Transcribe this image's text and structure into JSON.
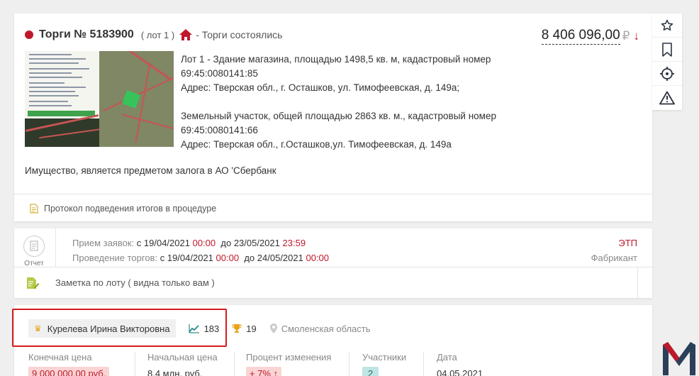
{
  "lot": {
    "title": "Торги № 5183900",
    "lot_number": "( лот 1 )",
    "status": "- Торги состоялись",
    "price": "8 406 096,00",
    "currency": "₽",
    "description_lines": [
      "Лот 1 - Здание магазина, площадью 1498,5 кв. м, кадастровый номер",
      "69:45:0080141:85",
      "Адрес: Тверская обл., г. Осташков, ул. Тимофеевская, д. 149а;",
      "",
      "Земельный участок, общей площадью 2863 кв. м., кадастровый номер",
      "69:45:0080141:66",
      "Адрес: Тверская обл., г.Осташков,ул. Тимофеевская, д. 149а"
    ],
    "note": "Имущество, является предметом залога в АО 'Сбербанк",
    "protocol_link": "Протокол подведения итогов в процедуре"
  },
  "schedule": {
    "report_label": "Отчет",
    "applications_label": "Прием заявок:",
    "applications_from_prefix": "с",
    "applications_from_date": "19/04/2021",
    "applications_from_time": "00:00",
    "applications_to_prefix": "до",
    "applications_to_date": "23/05/2021",
    "applications_to_time": "23:59",
    "auction_label": "Проведение торгов:",
    "auction_from_prefix": "с",
    "auction_from_date": "19/04/2021",
    "auction_from_time": "00:00",
    "auction_to_prefix": "до",
    "auction_to_date": "24/05/2021",
    "auction_to_time": "00:00",
    "etp_label": "ЭТП",
    "etp_name": "Фабрикант",
    "lot_note": "Заметка по лоту ( видна только вам )"
  },
  "winner": {
    "name": "Курелева Ирина Викторовна",
    "trend_count": "183",
    "trophy_count": "19",
    "region": "Смоленская область",
    "metrics": [
      {
        "label": "Конечная цена",
        "value": "9 000 000,00 руб."
      },
      {
        "label": "Начальная цена",
        "value": "8,4 млн. руб."
      },
      {
        "label": "Процент изменения",
        "value": "+ 7% ↑"
      },
      {
        "label": "Участники",
        "value": "2"
      },
      {
        "label": "Дата",
        "value": "04.05.2021"
      }
    ]
  },
  "side_toolbar": [
    "star-icon",
    "bookmark-icon",
    "target-icon",
    "warning-icon"
  ],
  "colors": {
    "accent_red": "#c0182b",
    "highlight_box": "#d21b1b",
    "teal_badge": "#bfe4e4",
    "crown": "#e8a31b"
  }
}
